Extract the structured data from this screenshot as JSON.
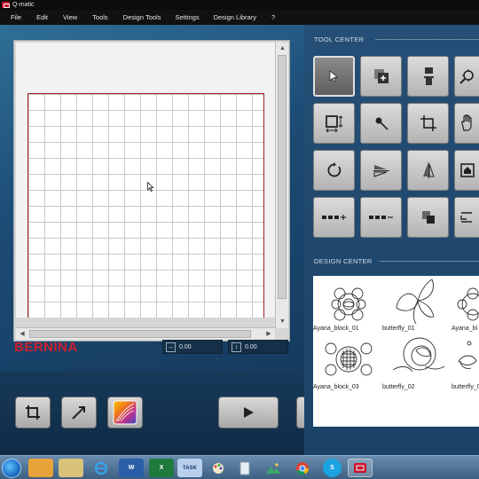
{
  "window": {
    "title": "Q-matic"
  },
  "menu": [
    "File",
    "Edit",
    "View",
    "Tools",
    "Design Tools",
    "Settings",
    "Design Library",
    "?"
  ],
  "brand": {
    "label": "BERNINA",
    "color": "#d01f2f"
  },
  "coords": {
    "width_value": "0.00",
    "height_value": "0.00"
  },
  "tool_center": {
    "title": "TOOL CENTER"
  },
  "design_center": {
    "title": "DESIGN CENTER",
    "items": [
      {
        "label": "Ayana_block_01"
      },
      {
        "label": "butterfly_01"
      },
      {
        "label": "Ayana_bl"
      },
      {
        "label": "Ayana_block_03"
      },
      {
        "label": "butterfly_02"
      },
      {
        "label": "butterfly_0"
      }
    ]
  },
  "taskbar": {
    "items": [
      {
        "name": "outlook-icon",
        "label": ""
      },
      {
        "name": "explorer-icon",
        "label": ""
      },
      {
        "name": "ie-icon",
        "label": ""
      },
      {
        "name": "word-icon",
        "label": "W"
      },
      {
        "name": "excel-icon",
        "label": "X"
      },
      {
        "name": "task-icon",
        "label": "TASK"
      },
      {
        "name": "paint-icon",
        "label": ""
      },
      {
        "name": "file-icon",
        "label": ""
      },
      {
        "name": "photos-icon",
        "label": ""
      },
      {
        "name": "chrome-icon",
        "label": ""
      },
      {
        "name": "skype-icon",
        "label": "S"
      },
      {
        "name": "qmatic-icon",
        "label": ""
      }
    ]
  },
  "colors": {
    "accent": "#d01f2f",
    "panel": "#1c4268"
  }
}
